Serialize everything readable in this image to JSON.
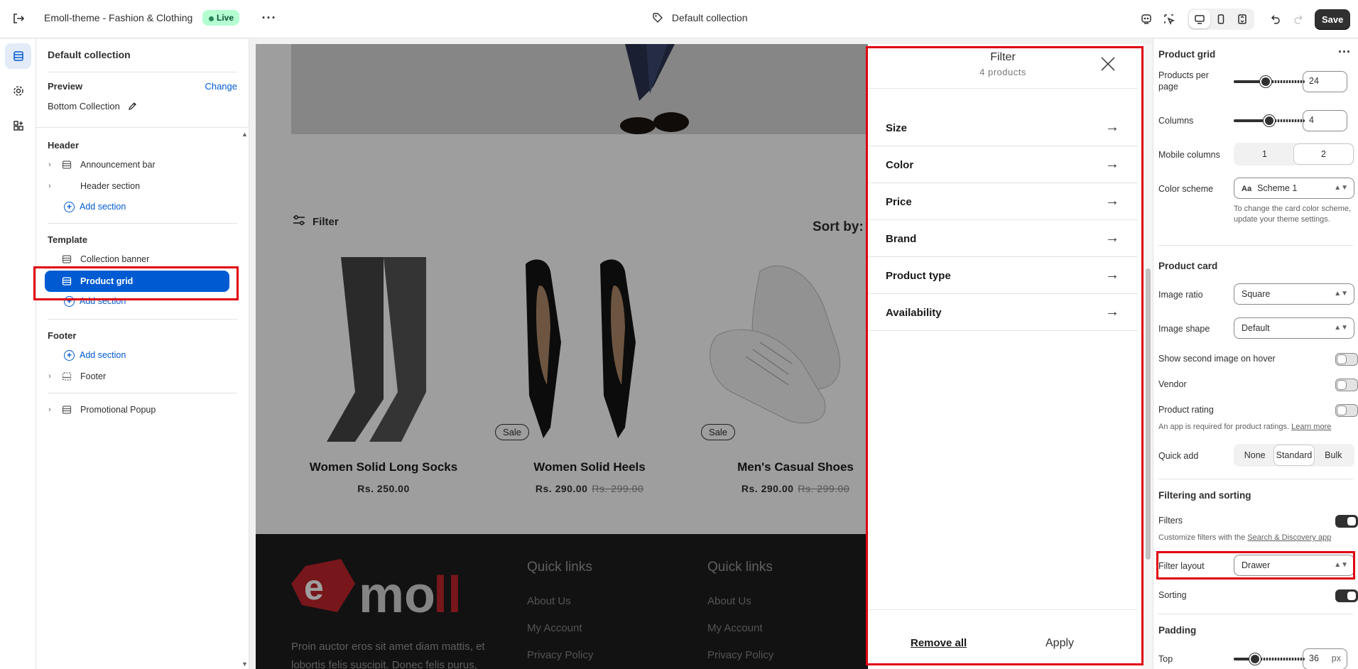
{
  "topbar": {
    "theme_name": "Emoll-theme - Fashion & Clothing",
    "live_badge": "Live",
    "page_name": "Default collection",
    "save_label": "Save"
  },
  "sidebar": {
    "title": "Default collection",
    "preview_label": "Preview",
    "change_link": "Change",
    "preview_value": "Bottom Collection",
    "header_group": "Header",
    "header_items": [
      "Announcement bar",
      "Header section"
    ],
    "add_section": "Add section",
    "template_group": "Template",
    "template_items": [
      "Collection banner",
      "Product grid"
    ],
    "footer_group": "Footer",
    "footer_items": [
      "Footer"
    ],
    "popup_item": "Promotional Popup"
  },
  "preview": {
    "filter_label": "Filter",
    "sort_label": "Sort by:",
    "products": [
      {
        "name": "Women Solid Long Socks",
        "price": "Rs. 250.00",
        "compare": "",
        "sale": ""
      },
      {
        "name": "Women Solid Heels",
        "price": "Rs. 290.00",
        "compare": "Rs. 299.00",
        "sale": "Sale"
      },
      {
        "name": "Men's Casual Shoes",
        "price": "Rs. 290.00",
        "compare": "Rs. 299.00",
        "sale": "Sale"
      }
    ],
    "footer": {
      "logo_text_e": "e",
      "logo_text_mo": "mo",
      "logo_text_ll": "ll",
      "about": "Proin auctor eros sit amet diam mattis, et lobortis felis suscipit. Donec felis purus,",
      "col1_heading": "Quick links",
      "col1_links": [
        "About Us",
        "My Account",
        "Privacy Policy"
      ],
      "col2_heading": "Quick links",
      "col2_links": [
        "About Us",
        "My Account",
        "Privacy Policy"
      ]
    },
    "drawer": {
      "title": "Filter",
      "count": "4 products",
      "rows": [
        "Size",
        "Color",
        "Price",
        "Brand",
        "Product type",
        "Availability"
      ],
      "remove_all": "Remove all",
      "apply": "Apply"
    }
  },
  "settings": {
    "section_title": "Product grid",
    "products_per_page_label": "Products per page",
    "products_per_page": "24",
    "products_per_page_fraction": 0.45,
    "columns_label": "Columns",
    "columns": "4",
    "columns_fraction": 0.5,
    "mobile_columns_label": "Mobile columns",
    "mobile_options": [
      "1",
      "2"
    ],
    "color_scheme_label": "Color scheme",
    "color_scheme_value": "Scheme 1",
    "color_scheme_icon": "Aa",
    "color_scheme_help": "To change the card color scheme, update your theme settings.",
    "product_card_heading": "Product card",
    "image_ratio_label": "Image ratio",
    "image_ratio_value": "Square",
    "image_shape_label": "Image shape",
    "image_shape_value": "Default",
    "second_image_label": "Show second image on hover",
    "vendor_label": "Vendor",
    "rating_label": "Product rating",
    "rating_help": "An app is required for product ratings.",
    "learn_more": "Learn more",
    "quick_add_label": "Quick add",
    "quick_add_options": [
      "None",
      "Standard",
      "Bulk"
    ],
    "filtering_heading": "Filtering and sorting",
    "filters_label": "Filters",
    "filters_help": "Customize filters with the",
    "filters_help_link": "Search & Discovery app",
    "filter_layout_label": "Filter layout",
    "filter_layout_value": "Drawer",
    "sorting_label": "Sorting",
    "padding_heading": "Padding",
    "top_label": "Top",
    "top_value": "36",
    "top_unit": "px",
    "top_fraction": 0.3
  },
  "colors": {
    "accent": "#005bd3",
    "highlight": "#e00010",
    "dark": "#303030"
  }
}
